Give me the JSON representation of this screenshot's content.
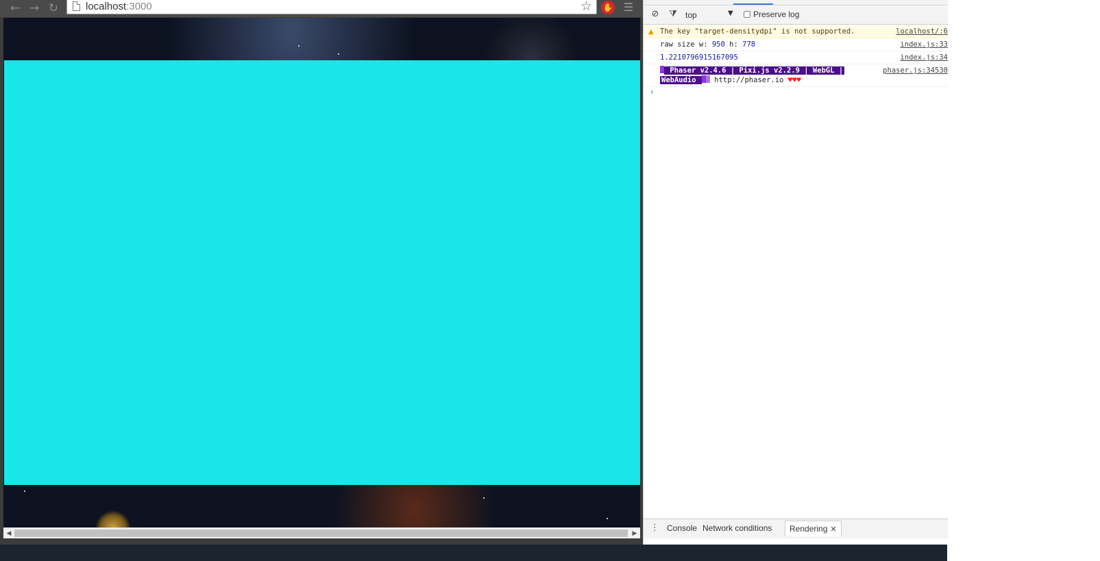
{
  "browser": {
    "url_host": "localhost",
    "url_port": ":3000",
    "icons": {
      "back": "arrow-left",
      "forward": "arrow-right",
      "reload": "reload",
      "page": "page",
      "bookmark": "star",
      "extension": "stop-hand",
      "menu": "hamburger"
    }
  },
  "game": {
    "canvas_color": "#19e6e6"
  },
  "devtools": {
    "toolbar": {
      "context": "top",
      "preserve_log_label": "Preserve log"
    },
    "messages": [
      {
        "type": "warning",
        "text": "The key \"target-densitydpi\" is not supported.",
        "source": "localhost/:6"
      },
      {
        "type": "log",
        "prefix_w": "raw size w: ",
        "w": "950",
        "prefix_h": " h: ",
        "h": "778",
        "source": "index.js:33"
      },
      {
        "type": "log",
        "text": "1.2210796915167095",
        "source": "index.js:34"
      },
      {
        "type": "log",
        "phaser_line1": " Phaser v2.4.6 | Pixi.js v2.2.9 | WebGL | ",
        "phaser_line2": "WebAudio ",
        "link": " http://phaser.io ",
        "hearts": "♥♥♥",
        "source": "phaser.js:34530"
      }
    ],
    "drawer": {
      "tabs": [
        "Console",
        "Network conditions",
        "Rendering"
      ]
    }
  }
}
